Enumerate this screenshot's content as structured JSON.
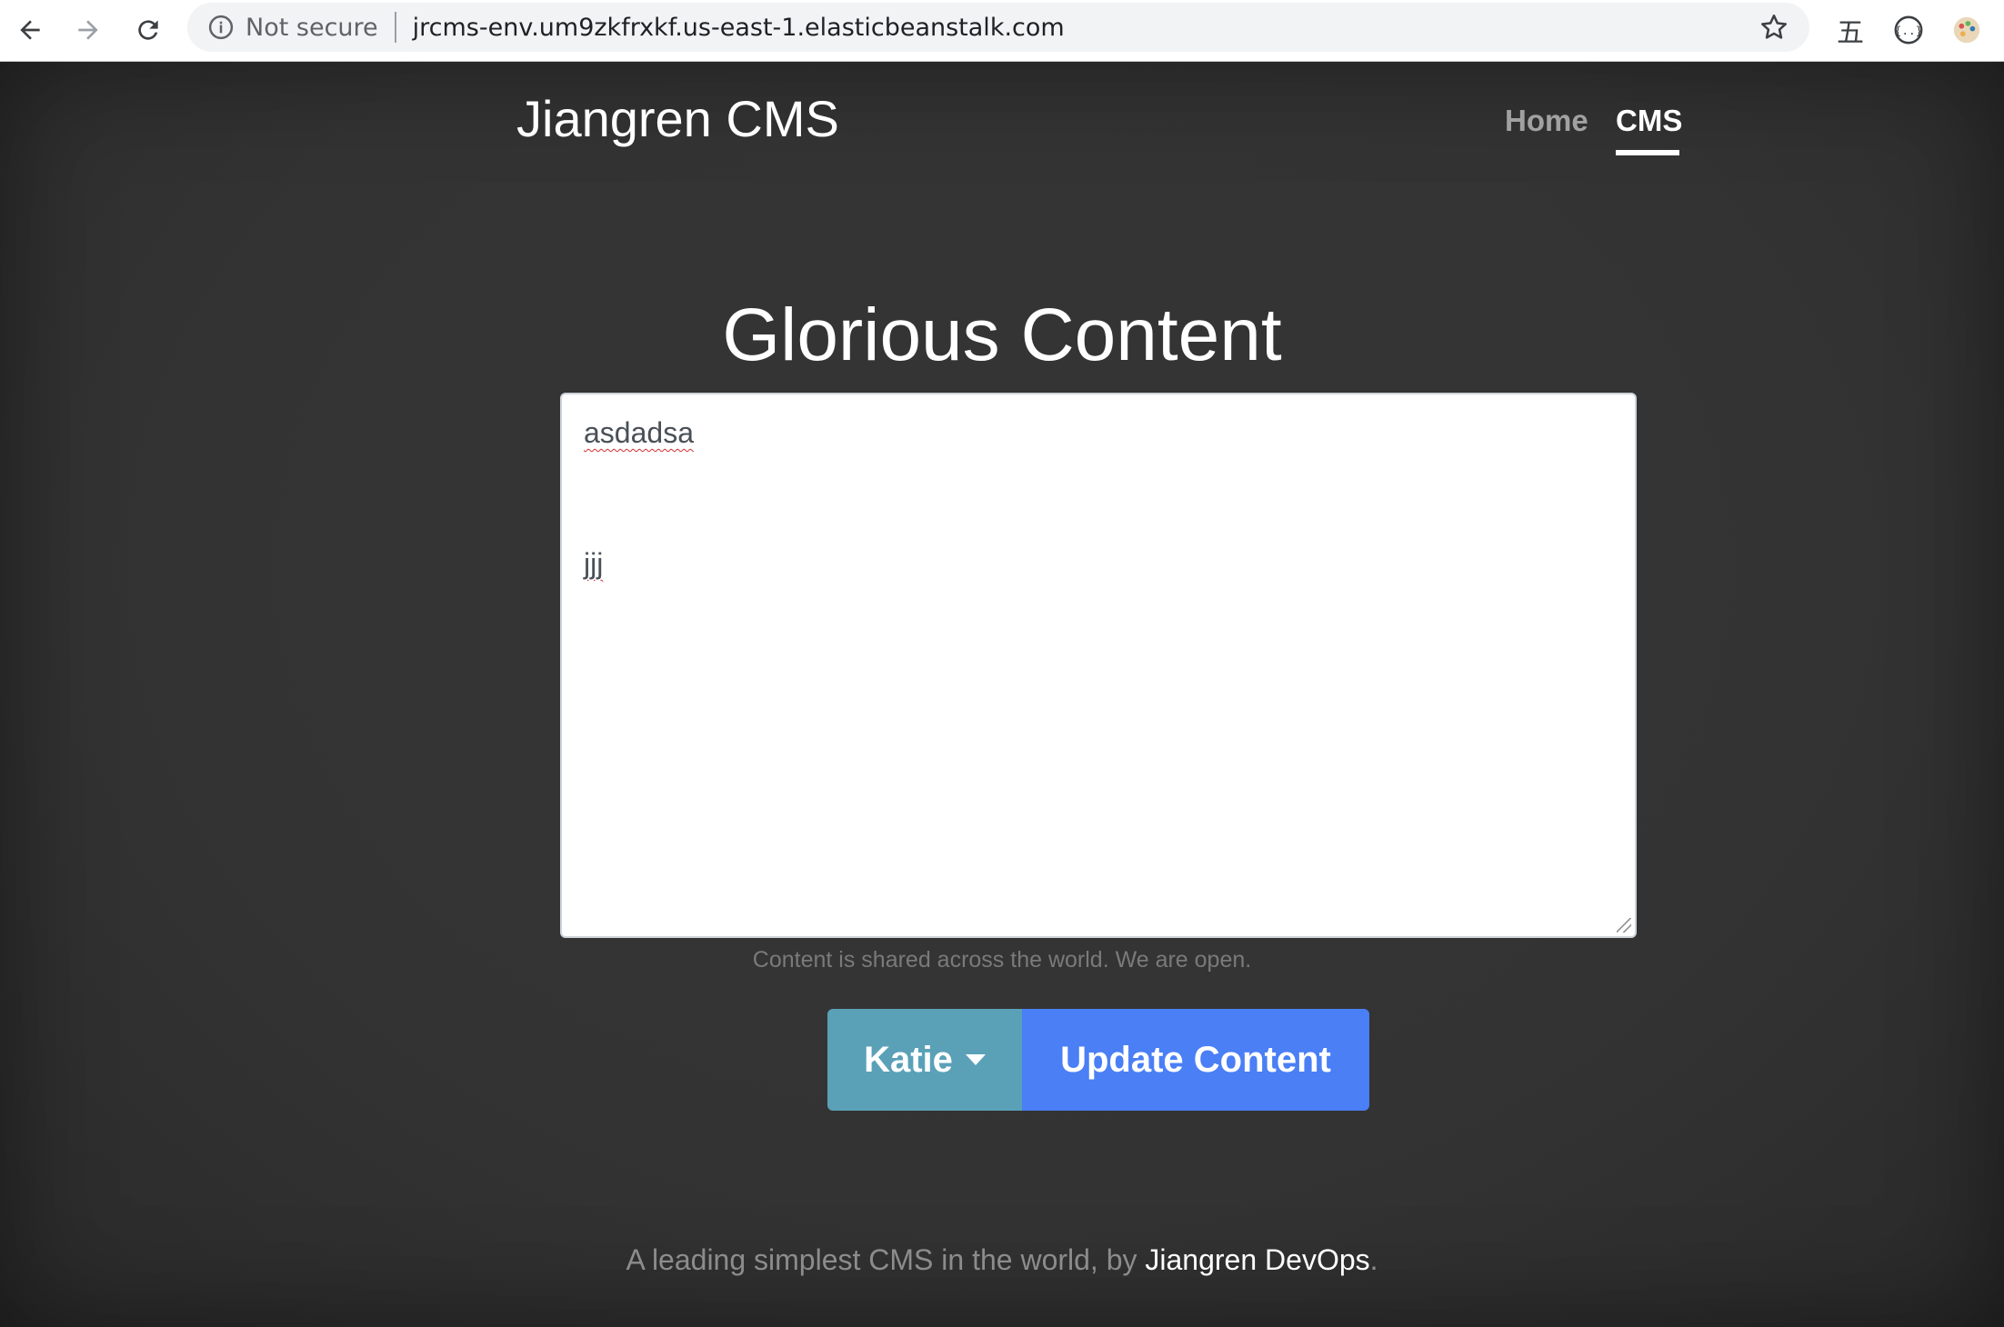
{
  "browser": {
    "security_label": "Not secure",
    "url": "jrcms-env.um9zkfrxkf.us-east-1.elasticbeanstalk.com",
    "ext_char": "五"
  },
  "nav": {
    "brand": "Jiangren CMS",
    "links": [
      {
        "label": "Home"
      },
      {
        "label": "CMS"
      }
    ]
  },
  "main": {
    "title": "Glorious Content",
    "content_lines": [
      "asdadsa",
      "",
      "jjj"
    ],
    "helper_text": "Content is shared across the world. We are open.",
    "user_button": "Katie",
    "update_button": "Update Content"
  },
  "footer": {
    "prefix": "A leading simplest CMS in the world, by ",
    "author": "Jiangren DevOps",
    "suffix": "."
  },
  "colors": {
    "user_button": "#5aa1b8",
    "update_button": "#4a7ff5",
    "background": "#333333"
  }
}
